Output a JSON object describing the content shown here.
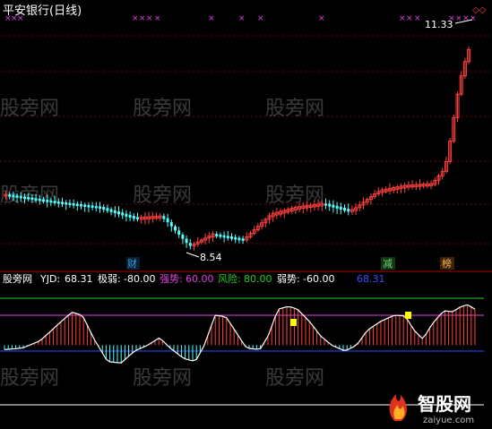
{
  "window": {
    "title": "平安银行(日线)"
  },
  "main_chart": {
    "high_label": "11.33",
    "low_label": "8.54",
    "info_mine_marker": "×",
    "watermark": "股旁网",
    "events": [
      {
        "label": "财",
        "color": "#2e9be0"
      },
      {
        "label": "减",
        "color": "#3a9a3a"
      },
      {
        "label": "榜",
        "color": "#ff9a2e"
      }
    ]
  },
  "indicator_panel": {
    "header": {
      "name": "股旁网",
      "yjd_label": "YJD:",
      "yjd_value": "68.31",
      "jiruo_label": "极弱:",
      "jiruo_value": "-80.00",
      "qiangshi_label": "强势:",
      "qiangshi_value": "60.00",
      "fengxian_label": "风险:",
      "fengxian_value": "80.00",
      "ruoshi_label": "弱势:",
      "ruoshi_value": "-60.00",
      "extra_value": "68.31"
    },
    "levels": {
      "risk": 80,
      "strong": 60,
      "weak": -60,
      "extreme_weak": -80
    }
  },
  "brand": {
    "name": "智股网",
    "url": "zaiyue.com"
  },
  "colors": {
    "background": "#000000",
    "up_candle": "#ff4040",
    "down_candle": "#54ffff",
    "grid": "#7a0000",
    "panel_border": "#b00000",
    "risk_line": "#22cc22",
    "strong_line": "#e040e0",
    "weak_line": "#3050ff",
    "extreme_line": "#ffffff",
    "yjd_line": "#ffffff",
    "signal": "#ffff00",
    "marker": "#e040e0"
  },
  "chart_data": {
    "type": "candlestick",
    "symbol_title": "平安银行(日线)",
    "annotated_high": 11.33,
    "annotated_low": 8.54,
    "indicator": {
      "name": "YJD",
      "last_value": 68.31,
      "levels": {
        "risk": 80,
        "strong": 60,
        "weak": -60,
        "extreme_weak": -80
      }
    }
  }
}
